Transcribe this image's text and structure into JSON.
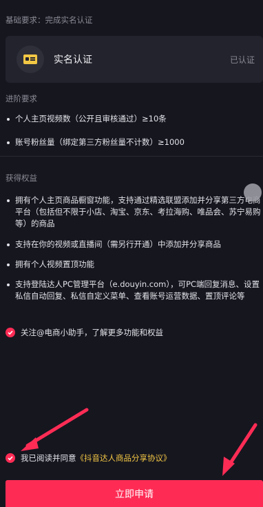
{
  "basic": {
    "label": "基础要求：完成实名认证"
  },
  "verify_card": {
    "icon": "id-card-icon",
    "title": "实名认证",
    "status": "已认证"
  },
  "advanced": {
    "label": "进阶要求",
    "items": [
      "个人主页视频数（公开且审核通过）≥10条",
      "账号粉丝量（绑定第三方粉丝量不计数）≥1000"
    ]
  },
  "benefits": {
    "label": "获得权益",
    "items": [
      "拥有个人主页商品橱窗功能，支持通过精选联盟添加并分享第三方电商平台（包括但不限于小店、淘宝、京东、考拉海购、唯品会、苏宁易购等）的商品",
      "支持在你的视频或直播间（需另行开通）中添加并分享商品",
      "拥有个人视频置顶功能",
      "支持登陆达人PC管理平台（e.douyin.com），可PC端回复消息、设置私信自动回复、私信自定义菜单、查看账号运营数据、置顶评论等"
    ]
  },
  "follow": {
    "text": "关注@电商小助手，了解更多功能和权益",
    "checked": true
  },
  "agreement": {
    "prefix": "我已阅读并同意",
    "link": "《抖音达人商品分享协议》",
    "checked": true
  },
  "submit": {
    "label": "立即申请"
  },
  "colors": {
    "accent": "#fe2c55",
    "link": "#f2c744",
    "background": "#16161f"
  }
}
